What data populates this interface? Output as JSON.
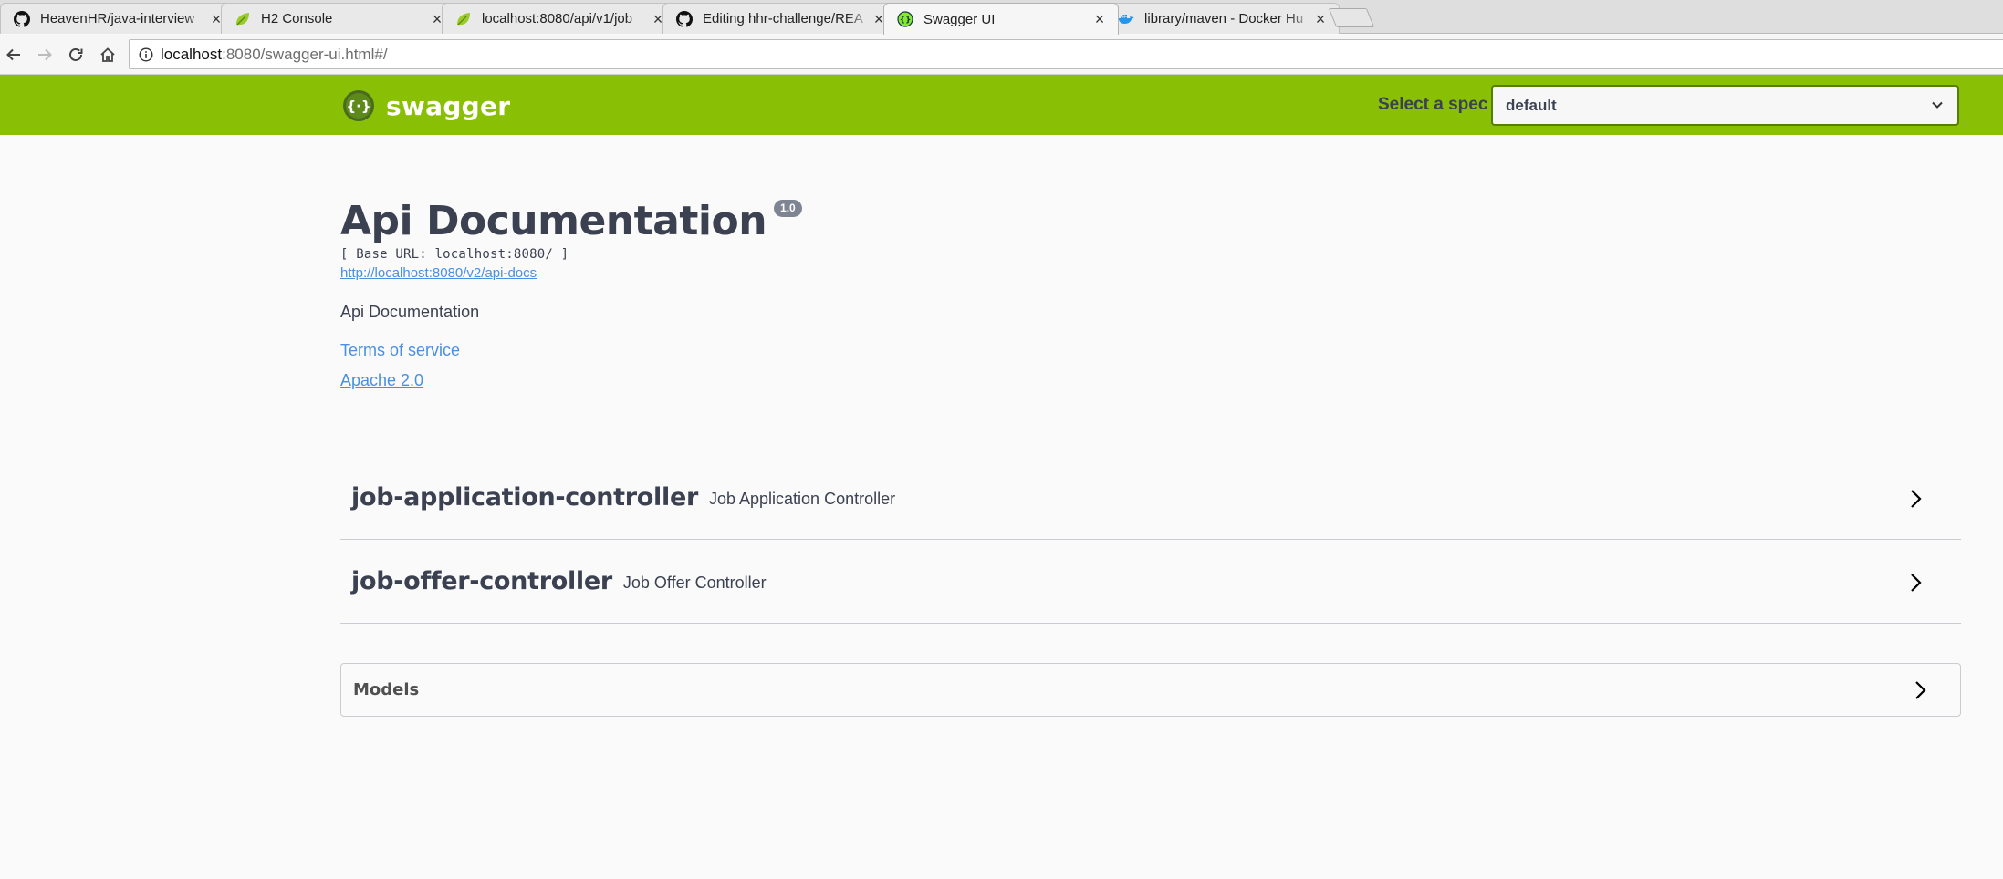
{
  "browser": {
    "tabs": [
      {
        "title": "HeavenHR/java-interview",
        "favicon": "github-icon",
        "active": false
      },
      {
        "title": "H2 Console",
        "favicon": "spring-leaf-icon",
        "active": false
      },
      {
        "title": "localhost:8080/api/v1/job",
        "favicon": "spring-leaf-icon",
        "active": false
      },
      {
        "title": "Editing hhr-challenge/REA",
        "favicon": "github-icon",
        "active": false
      },
      {
        "title": "Swagger UI",
        "favicon": "swagger-icon",
        "active": true
      },
      {
        "title": "library/maven - Docker Hu",
        "favicon": "docker-icon",
        "active": false
      }
    ],
    "url_host": "localhost",
    "url_path": ":8080/swagger-ui.html#/"
  },
  "topbar": {
    "logo_text": "swagger",
    "spec_label": "Select a spec",
    "spec_selected": "default",
    "background_color": "#89bf04"
  },
  "info": {
    "title": "Api Documentation",
    "version": "1.0",
    "base_url": "[ Base URL: localhost:8080/ ]",
    "docs_url": "http://localhost:8080/v2/api-docs",
    "description": "Api Documentation",
    "terms_label": "Terms of service",
    "license_label": "Apache 2.0"
  },
  "tags": [
    {
      "name": "job-application-controller",
      "description": "Job Application Controller"
    },
    {
      "name": "job-offer-controller",
      "description": "Job Offer Controller"
    }
  ],
  "models": {
    "label": "Models"
  },
  "colors": {
    "text_dark": "#3b4151",
    "link": "#4990e2",
    "version_badge": "#7d8492"
  }
}
